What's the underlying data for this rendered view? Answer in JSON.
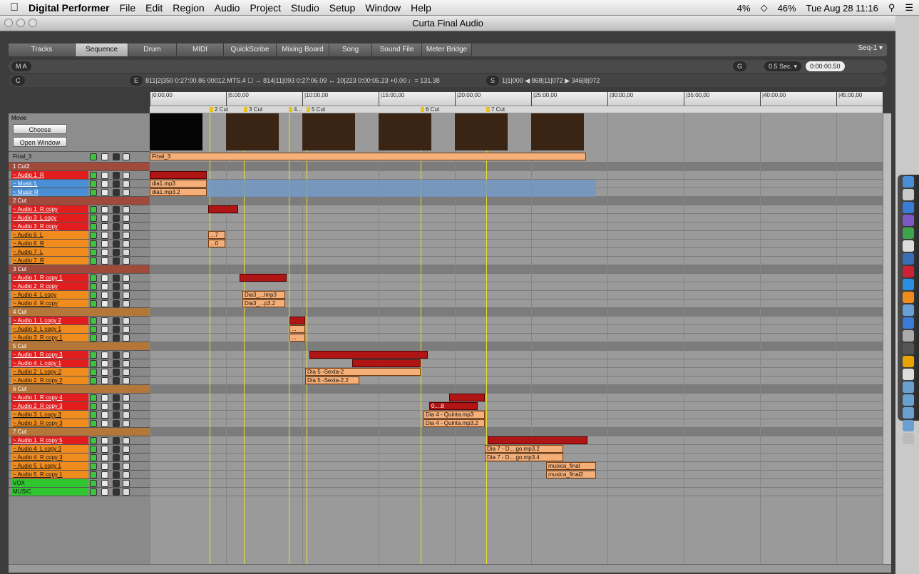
{
  "menubar": {
    "app": "Digital Performer",
    "items": [
      "File",
      "Edit",
      "Region",
      "Audio",
      "Project",
      "Studio",
      "Setup",
      "Window",
      "Help"
    ],
    "cpu": "4%",
    "battery": "46%",
    "clock": "Tue Aug 28 11:16"
  },
  "window": {
    "title": "Curta Final Audio"
  },
  "tabs": [
    "Tracks",
    "Sequence",
    "Drum",
    "MIDI",
    "QuickScribe",
    "Mixing Board",
    "Song",
    "Sound File",
    "Meter Bridge"
  ],
  "active_tab": "Sequence",
  "sequence_menu": "Seq-1 ▾",
  "toolbar": {
    "ma": "M  A",
    "c": "C",
    "e": "E",
    "counter": "811|2|350   0:27:00.86  00012.MTS.4 ☐ →  814|11|093   0:27:06.09  ↔  10|223   0:00:05.23 +0.00  ♩= 131.38",
    "s": "S",
    "loop": "1|1|000  ◀  868|11|072  ▶  346|8|072",
    "g": "G",
    "grid": "0.5 Sec. ▾",
    "nudge": "0:00:00.50"
  },
  "ruler": [
    "|0:00,00",
    "|5:00,00",
    "|10:00,00",
    "|15:00,00",
    "|20:00,00",
    "|25:00,00",
    "|30:00,00",
    "|35:00,00",
    "|40:00,00",
    "|45:00,00"
  ],
  "markers": [
    "2 Cut",
    "3 Cut",
    "4...",
    "5 Cut",
    "6 Cut",
    "7 Cut"
  ],
  "movie": {
    "label": "Movie",
    "choose": "Choose",
    "open": "Open Window"
  },
  "tracks": [
    {
      "name": "Final_3",
      "kind": "final"
    },
    {
      "name": "1 Cut2",
      "kind": "folder"
    },
    {
      "name": "~ Audio 1_R",
      "kind": "red"
    },
    {
      "name": "~ Music L",
      "kind": "blue"
    },
    {
      "name": "~ Music R",
      "kind": "blue"
    },
    {
      "name": "2 Cut",
      "kind": "folder"
    },
    {
      "name": "~ Audio 1_R copy",
      "kind": "red"
    },
    {
      "name": "~ Audio 3_L copy",
      "kind": "red"
    },
    {
      "name": "~ Audio 3_R copy",
      "kind": "red"
    },
    {
      "name": "~ Audio 6_L",
      "kind": "orange"
    },
    {
      "name": "~ Audio 6_R",
      "kind": "orange"
    },
    {
      "name": "~ Audio 7_L",
      "kind": "orange"
    },
    {
      "name": "~ Audio 7_R",
      "kind": "orange"
    },
    {
      "name": "3 Cut",
      "kind": "folder"
    },
    {
      "name": "~ Audio 1_R copy 1",
      "kind": "red"
    },
    {
      "name": "~ Audio 2_R copy",
      "kind": "red"
    },
    {
      "name": "~ Audio 4_L copy",
      "kind": "orange"
    },
    {
      "name": "~ Audio 4_R copy",
      "kind": "orange"
    },
    {
      "name": "4 Cut",
      "kind": "folder-o"
    },
    {
      "name": "~ Audio 1_L copy 2",
      "kind": "red"
    },
    {
      "name": "~ Audio 3_L copy 1",
      "kind": "orange"
    },
    {
      "name": "~ Audio 3_R copy 1",
      "kind": "orange"
    },
    {
      "name": "5 Cut",
      "kind": "folder-o"
    },
    {
      "name": "~ Audio 1_R copy 3",
      "kind": "red"
    },
    {
      "name": "~ Audio 4_L copy 1",
      "kind": "red"
    },
    {
      "name": "~ Audio 2_L copy 2",
      "kind": "orange"
    },
    {
      "name": "~ Audio 2_R copy 2",
      "kind": "orange"
    },
    {
      "name": "6 Cut",
      "kind": "folder-o"
    },
    {
      "name": "~ Audio 1_R copy 4",
      "kind": "red"
    },
    {
      "name": "~ Audio 2_R copy 3",
      "kind": "red"
    },
    {
      "name": "~ Audio 3_L copy 3",
      "kind": "orange"
    },
    {
      "name": "~ Audio 3_R copy 3",
      "kind": "orange"
    },
    {
      "name": "7 Cut",
      "kind": "folder-o"
    },
    {
      "name": "~ Audio 1_R copy 5",
      "kind": "red"
    },
    {
      "name": "~ Audio 4_L copy 3",
      "kind": "orange"
    },
    {
      "name": "~ Audio 4_R copy 3",
      "kind": "orange"
    },
    {
      "name": "~ Audio 5_L copy 1",
      "kind": "orange"
    },
    {
      "name": "~ Audio 5_R copy 1",
      "kind": "orange"
    },
    {
      "name": "VOX",
      "kind": "green"
    },
    {
      "name": "MUSIC",
      "kind": "green"
    }
  ],
  "clips": {
    "final": "Final_3",
    "dia1": "dia1.mp3",
    "dia1b": "dia1.mp3.2",
    "dia3": "Dia3_...lmp3",
    "dia3b": "Dia3_...p3.2",
    "dia5": "Dia 5 -Sexta-2",
    "dia5b": "Dia 5 -Sexta-2.2",
    "q1": "Dia 4 - Quinta.mp3",
    "q2": "Dia 4 - Quinta.mp3.2",
    "d7a": "Dia 7 - D....go.mp3.2",
    "d7b": "Dia 7 - D....go.mp3.4",
    "mf1": "musica_final",
    "mf2": "musica_final2",
    "s7": "...7",
    "s0": "...0",
    "s8": "0....8",
    "dots": "..."
  },
  "colors": {
    "red": "#e11d1d",
    "orange": "#f08c1e",
    "blue": "#4a8fd6",
    "green": "#2fc62f",
    "marker": "#e8e02a"
  }
}
